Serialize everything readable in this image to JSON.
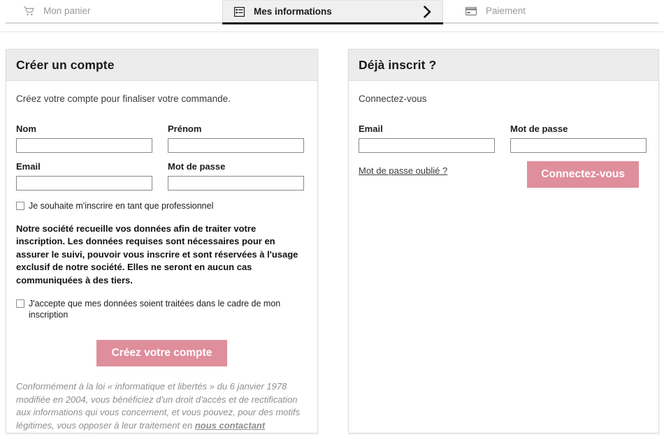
{
  "tabs": [
    {
      "id": "cart",
      "label": "Mon panier",
      "icon": "shopping-cart-icon",
      "active": false
    },
    {
      "id": "info",
      "label": "Mes informations",
      "icon": "form-list-icon",
      "active": true
    },
    {
      "id": "payment",
      "label": "Paiement",
      "icon": "credit-card-icon",
      "active": false
    }
  ],
  "colors": {
    "accent": "#df8e9b",
    "tab_active_bg": "#f0f0f0",
    "panel_head_bg": "#ececec",
    "panel_border": "#dddddd"
  },
  "register": {
    "title": "Créer un compte",
    "intro": "Créez votre compte pour finaliser votre commande.",
    "fields": [
      {
        "id": "nom",
        "label": "Nom",
        "value": "",
        "placeholder": ""
      },
      {
        "id": "prenom",
        "label": "Prénom",
        "value": "",
        "placeholder": ""
      },
      {
        "id": "email",
        "label": "Email",
        "value": "",
        "placeholder": ""
      },
      {
        "id": "password",
        "label": "Mot de passe",
        "value": "",
        "placeholder": ""
      }
    ],
    "pro_checkbox_label": "Je souhaite m'inscrire en tant que professionnel",
    "pro_checkbox_checked": false,
    "notice": "Notre société recueille vos données afin de traiter votre inscription. Les données requises sont nécessaires pour en assurer le suivi, pouvoir vous inscrire et sont réservées à l'usage exclusif de notre société. Elles ne seront en aucun cas communiquées à des tiers.",
    "consent_checkbox_label": "J'accepte que mes données soient traitées dans le cadre de mon inscription",
    "consent_checkbox_checked": false,
    "submit_label": "Créez votre compte",
    "legal_text_before": "Conformément à la loi « informatique et libertés » du 6 janvier 1978 modifiée en 2004, vous bénéficiez d'un droit d'accès et de rectification aux informations qui vous concernent, et vous pouvez, pour des motifs légitimes, vous opposer à leur traitement en ",
    "legal_link": "nous contactant"
  },
  "login": {
    "title": "Déjà inscrit ?",
    "intro": "Connectez-vous",
    "fields": [
      {
        "id": "login-email",
        "label": "Email",
        "value": "",
        "placeholder": ""
      },
      {
        "id": "login-password",
        "label": "Mot de passe",
        "value": "",
        "placeholder": ""
      }
    ],
    "forgot_label": "Mot de passe oublié ?",
    "submit_label": "Connectez-vous"
  }
}
